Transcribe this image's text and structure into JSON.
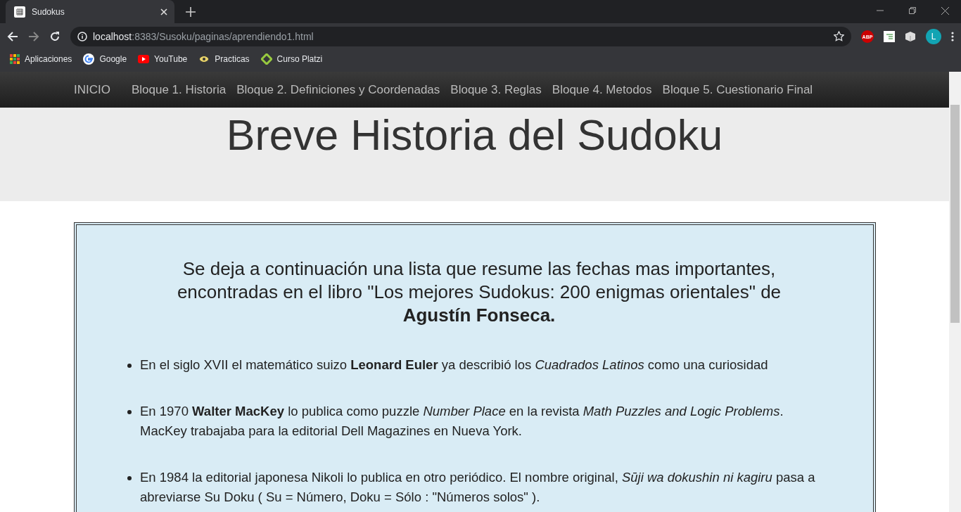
{
  "browser": {
    "tabs": [
      {
        "title": "Sudokus",
        "selected": true
      }
    ],
    "url_host": "localhost",
    "url_path": ":8383/Susoku/paginas/aprendiendo1.html",
    "profile_initial": "L",
    "extensions": [
      {
        "kind": "abp",
        "label": "ABP"
      },
      {
        "kind": "sheet"
      },
      {
        "kind": "cube"
      }
    ],
    "bookmarks": [
      {
        "kind": "apps",
        "label": "Aplicaciones"
      },
      {
        "kind": "google",
        "label": "Google"
      },
      {
        "kind": "youtube",
        "label": "YouTube"
      },
      {
        "kind": "practicas",
        "label": "Practicas"
      },
      {
        "kind": "platzi",
        "label": "Curso Platzi"
      }
    ]
  },
  "nav": [
    "INICIO",
    "Bloque 1. Historia",
    "Bloque 2. Definiciones y Coordenadas",
    "Bloque 3. Reglas",
    "Bloque 4. Metodos",
    "Bloque 5. Cuestionario Final"
  ],
  "title": "Breve Historia del Sudoku",
  "intro": "Se deja a continuación una lista que resume las fechas mas importantes, encontradas en el libro \"Los mejores Sudokus: 200 enigmas orientales\" de **Agustín Fonseca.**",
  "items": [
    "En el siglo XVII el matemático suizo **Leonard Euler** ya describió los *Cuadrados Latinos* como una curiosidad",
    "En 1970 **Walter MacKey** lo publica como puzzle *Number Place* en la revista *Math Puzzles and Logic Problems*. MacKey trabajaba para la editorial Dell Magazines en Nueva York.",
    "En 1984 la editorial japonesa Nikoli lo publica en otro periódico. El nombre original, *Sūji wa dokushin ni kagiru* pasa a abreviarse Su Doku ( Su = Número, Doku = Sólo : \"Números solos\" )."
  ]
}
